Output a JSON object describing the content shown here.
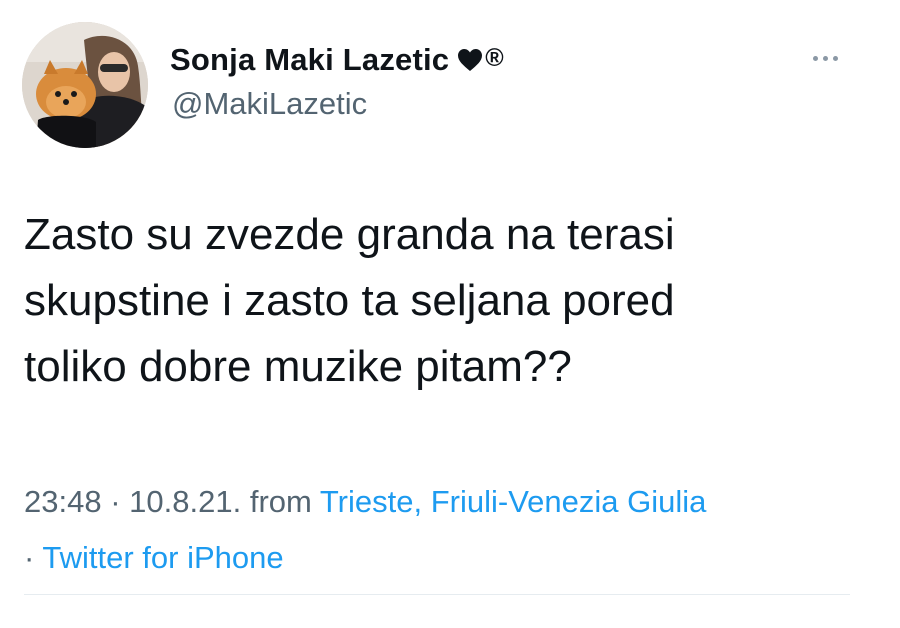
{
  "author": {
    "display_name": "Sonja Maki Lazetic",
    "badge_icon": "heart-icon",
    "registered_mark": "®",
    "handle": "@MakiLazetic"
  },
  "tweet": {
    "lines": [
      "Zasto su zvezde granda na terasi",
      "skupstine i zasto ta seljana pored",
      "toliko dobre muzike pitam??"
    ]
  },
  "meta": {
    "time": "23:48",
    "date": "10.8.21.",
    "from_label": "from",
    "location": "Trieste, Friuli-Venezia Giulia",
    "separator": "·",
    "source": "Twitter for iPhone"
  },
  "colors": {
    "text": "#0f1419",
    "secondary": "#536471",
    "link": "#1d9bf0"
  }
}
